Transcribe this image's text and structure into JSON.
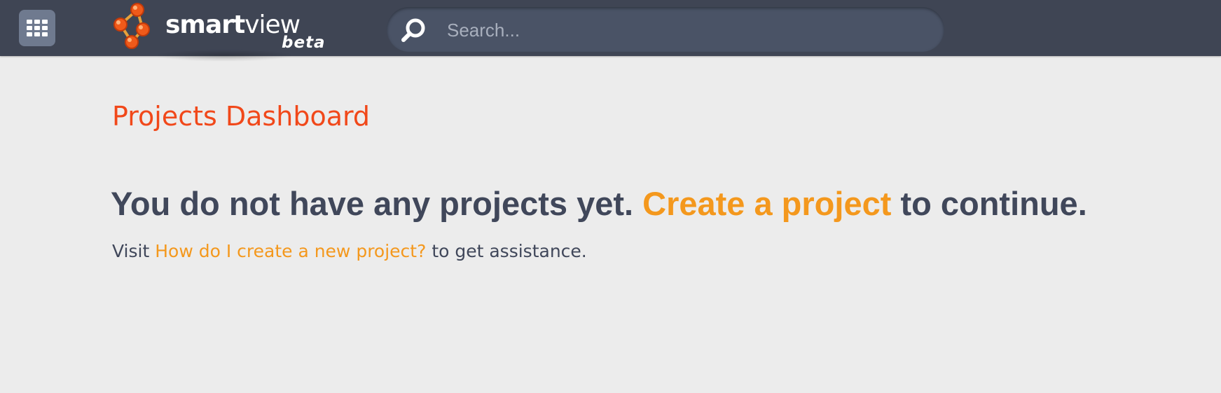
{
  "header": {
    "apps_icon": "grid-icon",
    "brand": {
      "name_bold": "smart",
      "name_light": "view",
      "tag": "beta",
      "logo_icon": "molecule-logo-icon",
      "colors": {
        "node": "#f05a1a",
        "node_dark": "#c13a0b",
        "link": "#e8a13a"
      }
    },
    "search": {
      "placeholder": "Search...",
      "value": "",
      "icon": "search-icon"
    },
    "colors": {
      "bar": "#3f4554",
      "apps_button": "#6f7a8f",
      "search_bg": "#4a5366"
    }
  },
  "main": {
    "title": "Projects Dashboard",
    "empty_state": {
      "before": "You do not have any projects yet. ",
      "link": "Create a project",
      "after": " to continue."
    },
    "help": {
      "before": "Visit ",
      "link": "How do I create a new project?",
      "after": " to get assistance."
    },
    "colors": {
      "background": "#ececec",
      "title": "#f1481a",
      "link": "#f4981d",
      "text": "#40475a"
    }
  }
}
